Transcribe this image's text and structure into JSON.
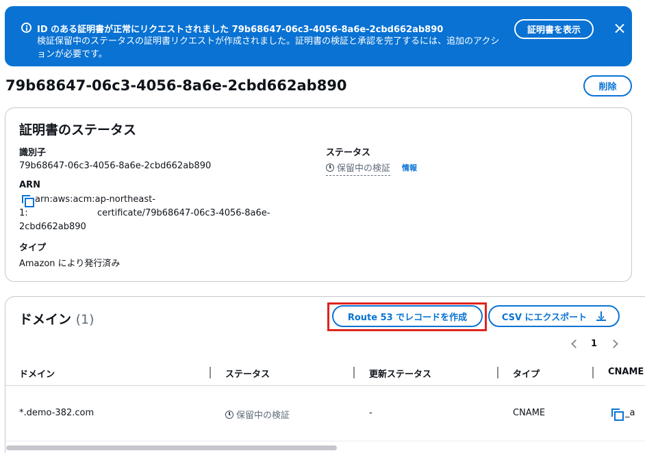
{
  "flash": {
    "title": "ID のある証明書が正常にリクエストされました 79b68647-06c3-4056-8a6e-2cbd662ab890",
    "body": "検証保留中のステータスの証明書リクエストが作成されました。証明書の検証と承認を完了するには、追加のアクションが必要です。",
    "view_button": "証明書を表示",
    "color": "#0972d3"
  },
  "page": {
    "title": "79b68647-06c3-4056-8a6e-2cbd662ab890",
    "delete_button": "削除"
  },
  "status_card": {
    "heading": "証明書のステータス",
    "identifier_label": "識別子",
    "identifier_value": "79b68647-06c3-4056-8a6e-2cbd662ab890",
    "status_label": "ステータス",
    "status_value": "保留中の検証",
    "info_link": "情報",
    "arn_label": "ARN",
    "arn_line1": "arn:aws:acm:ap-northeast-",
    "arn_line2a": "1:",
    "arn_line2b": "certificate/79b68647-06c3-4056-8a6e-",
    "arn_line3": "2cbd662ab890",
    "type_label": "タイプ",
    "type_value": "Amazon により発行済み"
  },
  "domains_card": {
    "heading": "ドメイン",
    "count": "(1)",
    "route53_button": "Route 53 でレコードを作成",
    "csv_button": "CSV にエクスポート",
    "page_number": "1",
    "columns": [
      "ドメイン",
      "ステータス",
      "更新ステータス",
      "タイプ",
      "CNAME"
    ],
    "rows": [
      {
        "domain": "*.demo-382.com",
        "status": "保留中の検証",
        "renewal_status": "-",
        "type": "CNAME",
        "cname": "_a"
      }
    ],
    "highlight_color": "#e0231b"
  }
}
